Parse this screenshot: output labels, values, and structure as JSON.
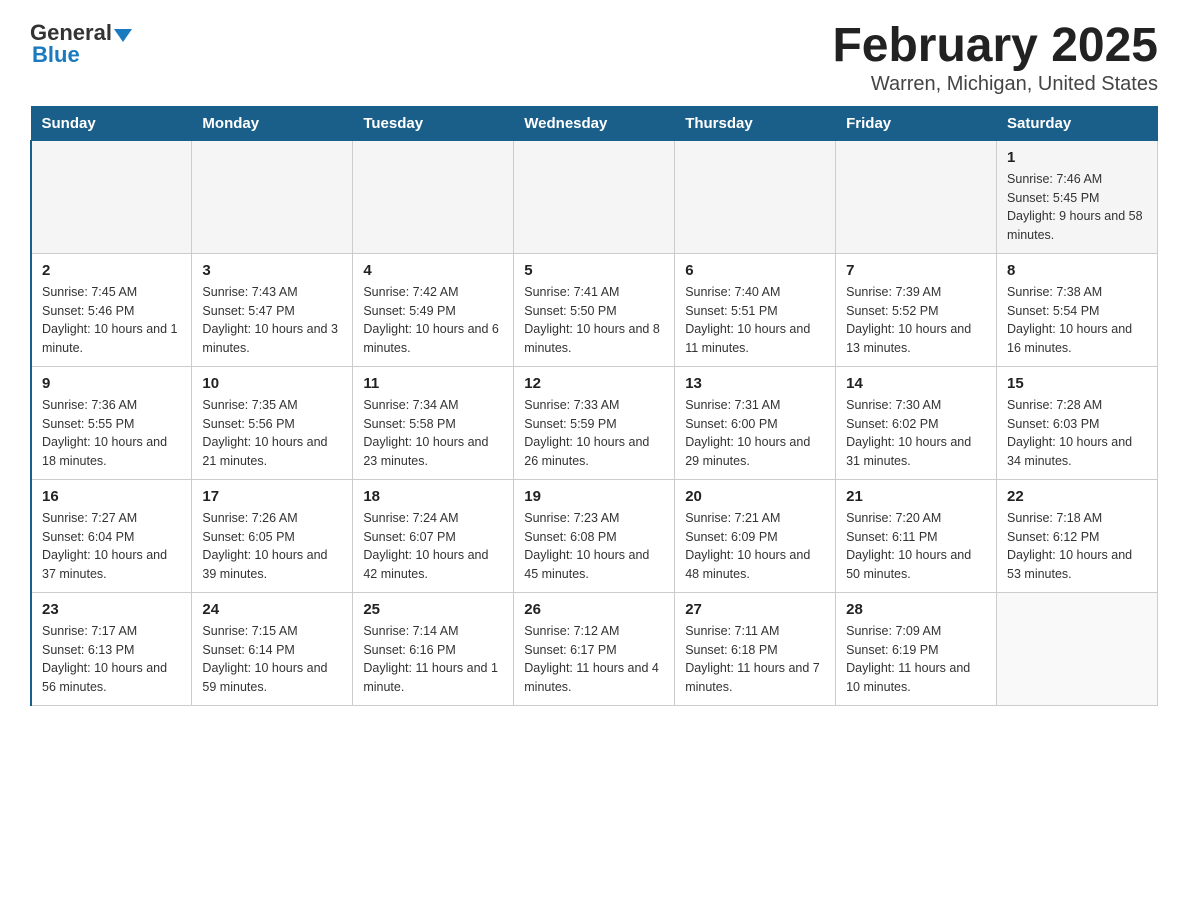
{
  "header": {
    "logo_general": "General",
    "logo_blue": "Blue",
    "title": "February 2025",
    "subtitle": "Warren, Michigan, United States"
  },
  "days_of_week": [
    "Sunday",
    "Monday",
    "Tuesday",
    "Wednesday",
    "Thursday",
    "Friday",
    "Saturday"
  ],
  "weeks": [
    [
      {
        "day": "",
        "sunrise": "",
        "sunset": "",
        "daylight": ""
      },
      {
        "day": "",
        "sunrise": "",
        "sunset": "",
        "daylight": ""
      },
      {
        "day": "",
        "sunrise": "",
        "sunset": "",
        "daylight": ""
      },
      {
        "day": "",
        "sunrise": "",
        "sunset": "",
        "daylight": ""
      },
      {
        "day": "",
        "sunrise": "",
        "sunset": "",
        "daylight": ""
      },
      {
        "day": "",
        "sunrise": "",
        "sunset": "",
        "daylight": ""
      },
      {
        "day": "1",
        "sunrise": "Sunrise: 7:46 AM",
        "sunset": "Sunset: 5:45 PM",
        "daylight": "Daylight: 9 hours and 58 minutes."
      }
    ],
    [
      {
        "day": "2",
        "sunrise": "Sunrise: 7:45 AM",
        "sunset": "Sunset: 5:46 PM",
        "daylight": "Daylight: 10 hours and 1 minute."
      },
      {
        "day": "3",
        "sunrise": "Sunrise: 7:43 AM",
        "sunset": "Sunset: 5:47 PM",
        "daylight": "Daylight: 10 hours and 3 minutes."
      },
      {
        "day": "4",
        "sunrise": "Sunrise: 7:42 AM",
        "sunset": "Sunset: 5:49 PM",
        "daylight": "Daylight: 10 hours and 6 minutes."
      },
      {
        "day": "5",
        "sunrise": "Sunrise: 7:41 AM",
        "sunset": "Sunset: 5:50 PM",
        "daylight": "Daylight: 10 hours and 8 minutes."
      },
      {
        "day": "6",
        "sunrise": "Sunrise: 7:40 AM",
        "sunset": "Sunset: 5:51 PM",
        "daylight": "Daylight: 10 hours and 11 minutes."
      },
      {
        "day": "7",
        "sunrise": "Sunrise: 7:39 AM",
        "sunset": "Sunset: 5:52 PM",
        "daylight": "Daylight: 10 hours and 13 minutes."
      },
      {
        "day": "8",
        "sunrise": "Sunrise: 7:38 AM",
        "sunset": "Sunset: 5:54 PM",
        "daylight": "Daylight: 10 hours and 16 minutes."
      }
    ],
    [
      {
        "day": "9",
        "sunrise": "Sunrise: 7:36 AM",
        "sunset": "Sunset: 5:55 PM",
        "daylight": "Daylight: 10 hours and 18 minutes."
      },
      {
        "day": "10",
        "sunrise": "Sunrise: 7:35 AM",
        "sunset": "Sunset: 5:56 PM",
        "daylight": "Daylight: 10 hours and 21 minutes."
      },
      {
        "day": "11",
        "sunrise": "Sunrise: 7:34 AM",
        "sunset": "Sunset: 5:58 PM",
        "daylight": "Daylight: 10 hours and 23 minutes."
      },
      {
        "day": "12",
        "sunrise": "Sunrise: 7:33 AM",
        "sunset": "Sunset: 5:59 PM",
        "daylight": "Daylight: 10 hours and 26 minutes."
      },
      {
        "day": "13",
        "sunrise": "Sunrise: 7:31 AM",
        "sunset": "Sunset: 6:00 PM",
        "daylight": "Daylight: 10 hours and 29 minutes."
      },
      {
        "day": "14",
        "sunrise": "Sunrise: 7:30 AM",
        "sunset": "Sunset: 6:02 PM",
        "daylight": "Daylight: 10 hours and 31 minutes."
      },
      {
        "day": "15",
        "sunrise": "Sunrise: 7:28 AM",
        "sunset": "Sunset: 6:03 PM",
        "daylight": "Daylight: 10 hours and 34 minutes."
      }
    ],
    [
      {
        "day": "16",
        "sunrise": "Sunrise: 7:27 AM",
        "sunset": "Sunset: 6:04 PM",
        "daylight": "Daylight: 10 hours and 37 minutes."
      },
      {
        "day": "17",
        "sunrise": "Sunrise: 7:26 AM",
        "sunset": "Sunset: 6:05 PM",
        "daylight": "Daylight: 10 hours and 39 minutes."
      },
      {
        "day": "18",
        "sunrise": "Sunrise: 7:24 AM",
        "sunset": "Sunset: 6:07 PM",
        "daylight": "Daylight: 10 hours and 42 minutes."
      },
      {
        "day": "19",
        "sunrise": "Sunrise: 7:23 AM",
        "sunset": "Sunset: 6:08 PM",
        "daylight": "Daylight: 10 hours and 45 minutes."
      },
      {
        "day": "20",
        "sunrise": "Sunrise: 7:21 AM",
        "sunset": "Sunset: 6:09 PM",
        "daylight": "Daylight: 10 hours and 48 minutes."
      },
      {
        "day": "21",
        "sunrise": "Sunrise: 7:20 AM",
        "sunset": "Sunset: 6:11 PM",
        "daylight": "Daylight: 10 hours and 50 minutes."
      },
      {
        "day": "22",
        "sunrise": "Sunrise: 7:18 AM",
        "sunset": "Sunset: 6:12 PM",
        "daylight": "Daylight: 10 hours and 53 minutes."
      }
    ],
    [
      {
        "day": "23",
        "sunrise": "Sunrise: 7:17 AM",
        "sunset": "Sunset: 6:13 PM",
        "daylight": "Daylight: 10 hours and 56 minutes."
      },
      {
        "day": "24",
        "sunrise": "Sunrise: 7:15 AM",
        "sunset": "Sunset: 6:14 PM",
        "daylight": "Daylight: 10 hours and 59 minutes."
      },
      {
        "day": "25",
        "sunrise": "Sunrise: 7:14 AM",
        "sunset": "Sunset: 6:16 PM",
        "daylight": "Daylight: 11 hours and 1 minute."
      },
      {
        "day": "26",
        "sunrise": "Sunrise: 7:12 AM",
        "sunset": "Sunset: 6:17 PM",
        "daylight": "Daylight: 11 hours and 4 minutes."
      },
      {
        "day": "27",
        "sunrise": "Sunrise: 7:11 AM",
        "sunset": "Sunset: 6:18 PM",
        "daylight": "Daylight: 11 hours and 7 minutes."
      },
      {
        "day": "28",
        "sunrise": "Sunrise: 7:09 AM",
        "sunset": "Sunset: 6:19 PM",
        "daylight": "Daylight: 11 hours and 10 minutes."
      },
      {
        "day": "",
        "sunrise": "",
        "sunset": "",
        "daylight": ""
      }
    ]
  ]
}
